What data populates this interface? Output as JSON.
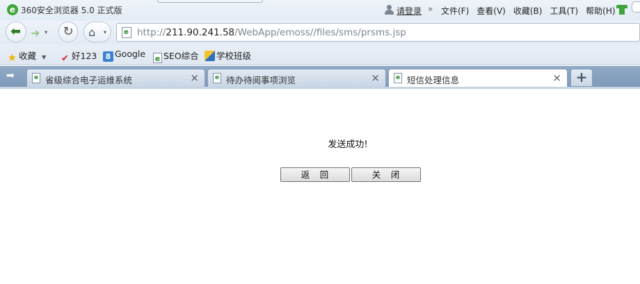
{
  "window": {
    "title": "360安全浏览器 5.0 正式版",
    "login_label": "请登录"
  },
  "menu": [
    "文件(F)",
    "查看(V)",
    "收藏(B)",
    "工具(T)",
    "帮助(H)"
  ],
  "address": {
    "scheme": "http://",
    "host": "211.90.241.58",
    "path": "/WebApp/emoss//files/sms/prsms.jsp"
  },
  "bookmarks": {
    "favorites": "收藏",
    "hao123": "好123",
    "google": "Google",
    "seo": "SEO综合",
    "school": "学校班级"
  },
  "tabs": [
    {
      "label": "省级综合电子运维系统",
      "active": false
    },
    {
      "label": "待办待阅事项浏览",
      "active": false
    },
    {
      "label": "短信处理信息",
      "active": true
    }
  ],
  "page": {
    "message": "发送成功!",
    "return_label": "返　回",
    "close_label": "关　闭"
  },
  "colors": {
    "tab_bar": "#8fa9c6",
    "nav_background": "#e9eff6",
    "back_arrow": "#2f7a24"
  },
  "icons": {
    "title": "ie-e-icon",
    "user": "user-icon",
    "skin": "shirt-icon",
    "back": "back-arrow-icon",
    "forward": "forward-arrow-icon",
    "refresh": "refresh-icon",
    "home": "home-icon",
    "page": "page-icon",
    "favorites": "star-icon",
    "sidebar": "sidebar-toggle-icon",
    "close": "close-icon",
    "new_tab": "plus-icon"
  }
}
